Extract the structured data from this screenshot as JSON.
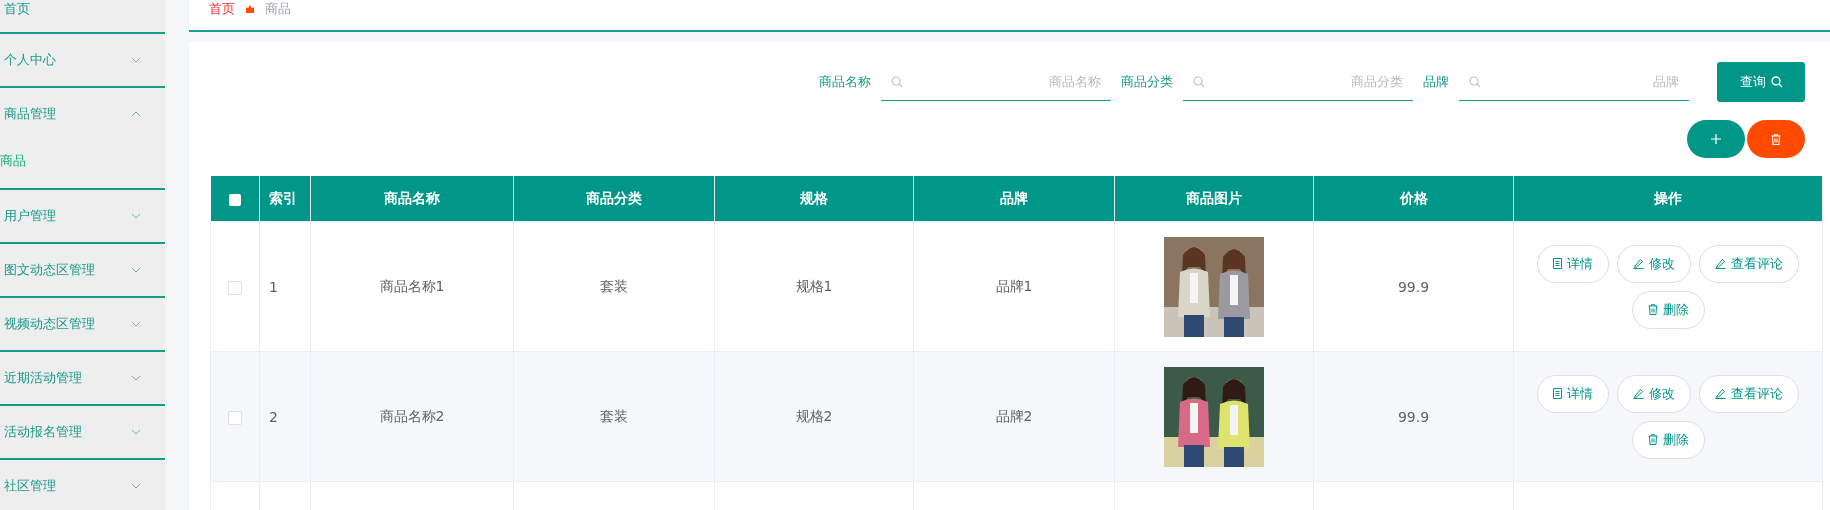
{
  "sidebar": {
    "items": [
      {
        "label": "首页",
        "kind": "link"
      },
      {
        "label": "个人中心",
        "kind": "menu",
        "expanded": false
      },
      {
        "label": "商品管理",
        "kind": "menu",
        "expanded": true,
        "children": [
          {
            "label": "商品"
          }
        ]
      },
      {
        "label": "用户管理",
        "kind": "menu",
        "expanded": false
      },
      {
        "label": "图文动态区管理",
        "kind": "menu",
        "expanded": false
      },
      {
        "label": "视频动态区管理",
        "kind": "menu",
        "expanded": false
      },
      {
        "label": "近期活动管理",
        "kind": "menu",
        "expanded": false
      },
      {
        "label": "活动报名管理",
        "kind": "menu",
        "expanded": false
      },
      {
        "label": "社区管理",
        "kind": "menu",
        "expanded": false
      }
    ]
  },
  "breadcrumb": [
    {
      "label": "首页",
      "current": false
    },
    {
      "label": "商品",
      "current": true
    }
  ],
  "search": {
    "fields": [
      {
        "label": "商品名称",
        "placeholder": "商品名称"
      },
      {
        "label": "商品分类",
        "placeholder": "商品分类"
      },
      {
        "label": "品牌",
        "placeholder": "品牌"
      }
    ],
    "button": "查询"
  },
  "table": {
    "header_checkbox": {
      "checked": false
    },
    "columns": [
      "索引",
      "商品名称",
      "商品分类",
      "规格",
      "品牌",
      "商品图片",
      "价格",
      "操作"
    ],
    "rows": [
      {
        "checked": false,
        "cells": [
          "1",
          "商品名称1",
          "套装",
          "规格1",
          "品牌1"
        ],
        "image": {
          "kind": "picture"
        },
        "price": "99.9",
        "actions": [
          {
            "label": "详情",
            "kind": "detail"
          },
          {
            "label": "修改",
            "kind": "edit"
          },
          {
            "label": "查看评论",
            "kind": "edit"
          },
          {
            "label": "删除",
            "kind": "delete"
          }
        ]
      },
      {
        "checked": false,
        "cells": [
          "2",
          "商品名称2",
          "套装",
          "规格2",
          "品牌2"
        ],
        "image": {
          "kind": "picture"
        },
        "price": "99.9",
        "actions": [
          {
            "label": "详情",
            "kind": "detail"
          },
          {
            "label": "修改",
            "kind": "edit"
          },
          {
            "label": "查看评论",
            "kind": "edit"
          },
          {
            "label": "删除",
            "kind": "delete"
          }
        ]
      }
    ]
  }
}
